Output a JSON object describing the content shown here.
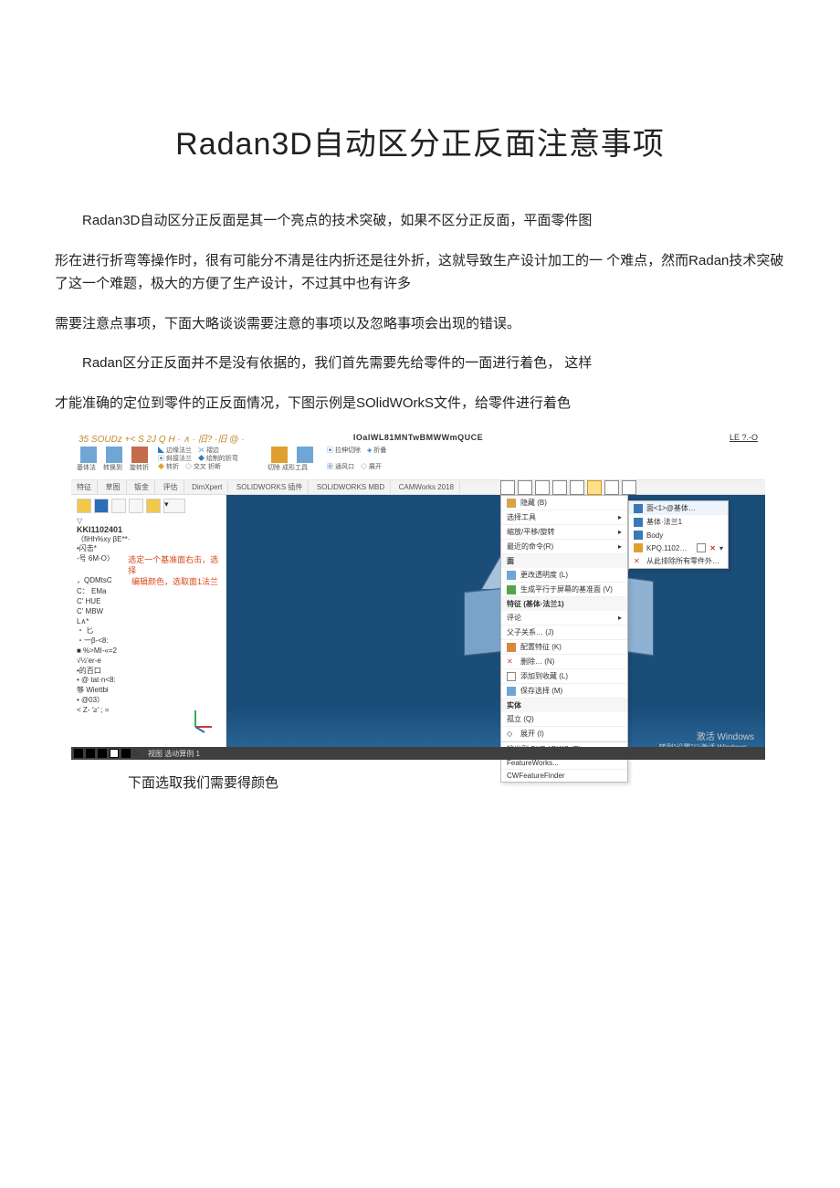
{
  "title": "Radan3D自动区分正反面注意事项",
  "paragraphs": {
    "p1": "Radan3D自动区分正反面是其一个亮点的技术突破，如果不区分正反面，平面零件图",
    "p2a": "形在进行折弯等操作时，很有可能分不清是往内折还是往外折，这就导致生产设计加工的一  个难点，然而Radan技术突破了这一个难题，极大的方便了生产设计，不过其中也有许多",
    "p3": "需要注意点事项，下面大略谈谈需要注意的事项以及忽略事项会出现的错误。",
    "p4": "Radan区分正反面并不是没有依据的，我们首先需要先给零件的一面进行着色， 这样",
    "p5": "才能准确的定位到零件的正反面情况，下图示例是SOlidWOrkS文件，给零件进行着色"
  },
  "caption": "下面选取我们需要得颜色",
  "shot": {
    "titlebar_left": "35 SOUDz +< S 2J Q H · ∧ · 旧? ·旧 @ ·",
    "titlebar_center": "IOalWL81MNTwBMWWmQUCE",
    "titlebar_right": "LE ?.-O",
    "ribbon_labels": [
      "基体法",
      "转换到",
      "旋转折",
      "边缘法兰",
      "斜接法兰",
      "褶边",
      "转折",
      "绘制的折弯",
      "交叉 折断",
      "切除",
      "成形工具",
      "拉伸切除",
      "通风口",
      "展开",
      "折叠"
    ],
    "tabs": [
      "特征",
      "草图",
      "钣金",
      "评估",
      "DimXpert",
      "SOLIDWORKS 插件",
      "SOLIDWORKS MBD",
      "CAMWorks 2018"
    ],
    "side_code": "KKI1102401",
    "side_line2": "（fiHh%xy βE**·",
    "side_hint1": "选定一个基准面右击，选择",
    "side_hint2": "编辑颜色，选取面1法兰",
    "tree_lines": [
      "•闪击*",
      "-号 6M-O〉",
      "，QDMtsC",
      "",
      "C： EMa",
      "C' HUE",
      "C' MBW",
      "L∧*",
      "・ 匕",
      "・一β-<8:",
      "■ %>MI-«=2",
      "",
      "√½'er-e",
      "•的百口",
      "• @ tat·n<8:",
      "够 Wiettbi",
      "• @03）",
      "< Z- '≥'    ; ="
    ],
    "statusbar_text": "视图   选动算例 1",
    "menu_header": "面",
    "menu_items": [
      "更改透明度 (L)",
      "生成平行于屏幕的基准面 (V)"
    ],
    "menu_section": "特征 (基体·法兰1)",
    "menu_items2": [
      "评论",
      "父子关系… (J)",
      "配置特征 (K)",
      "删除… (N)",
      "添加到收藏 (L)",
      "保存选择 (M)"
    ],
    "menu_section2": "实体",
    "menu_items3": [
      "孤立 (Q)",
      "展开 (I)"
    ],
    "menu_items4": [
      "输出到 DXF / DWG (E)",
      "FeatureWorks...",
      "CWFeatureFinder"
    ],
    "submenu_title": "面<1>@基体…",
    "submenu_items": [
      "基体·法兰1",
      "Body",
      "KPQ.1102…",
      "从此排除所有零件外…"
    ],
    "top_context": [
      "隐藏 (B)",
      "选择工具",
      "缩放/平移/旋转",
      "最近的命令(R)"
    ],
    "watermark1": "激活 Windows",
    "watermark2": "转到\"设置\"以激活 Windows。"
  }
}
